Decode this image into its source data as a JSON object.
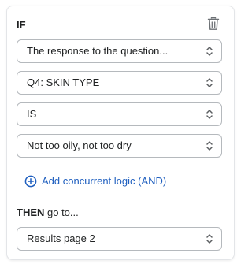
{
  "condition": {
    "if_label": "IF",
    "delete_icon": "trash-icon",
    "selects": [
      {
        "value": "The response to the question..."
      },
      {
        "value": "Q4: SKIN TYPE"
      },
      {
        "value": "IS"
      },
      {
        "value": "Not too oily, not too dry"
      }
    ],
    "add_logic_label": "Add concurrent logic (AND)",
    "add_logic_icon": "plus-circle-icon"
  },
  "action": {
    "then_label": "THEN",
    "then_suffix": " go to...",
    "destination": "Results page 2"
  },
  "colors": {
    "link": "#1f5fbf",
    "border": "#b5b9bd",
    "text": "#202223"
  }
}
